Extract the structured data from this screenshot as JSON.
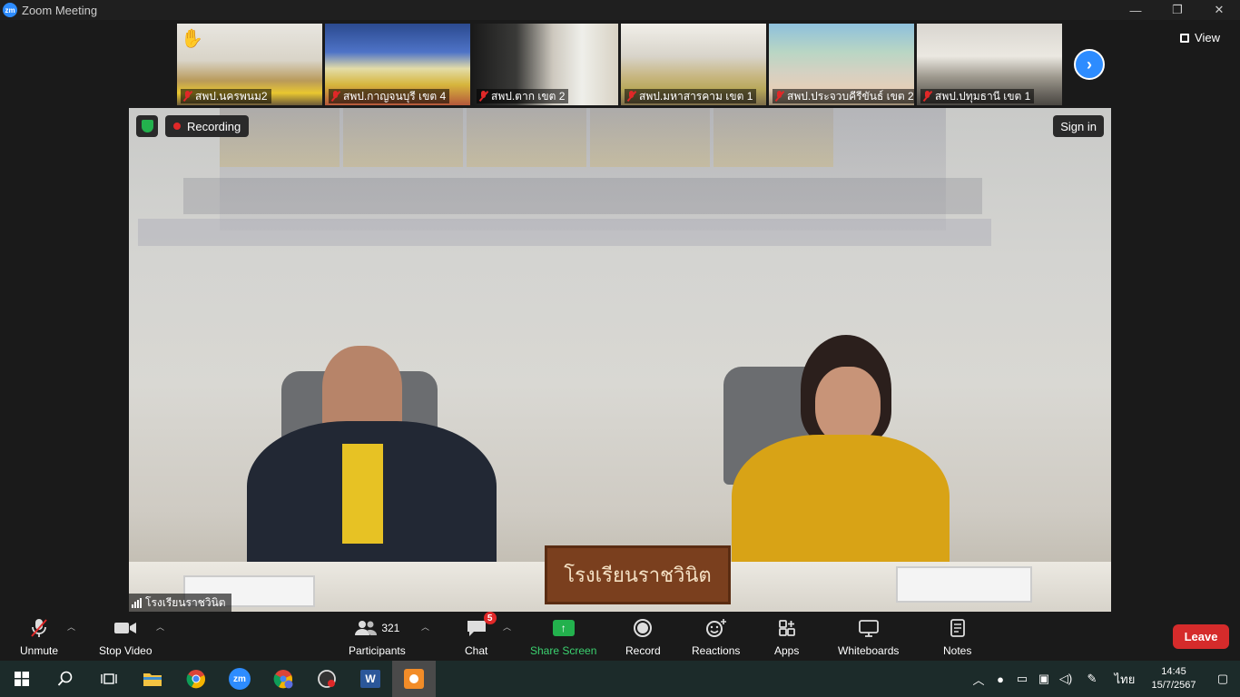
{
  "window": {
    "app_icon_text": "zm",
    "title": "Zoom Meeting",
    "controls": [
      "—",
      "❐",
      "✕"
    ]
  },
  "gallery": {
    "thumbnails": [
      {
        "label": "สพป.นครพนม2",
        "muted": true,
        "raised_hand": true
      },
      {
        "label": "สพป.กาญจนบุรี เขต 4",
        "muted": true,
        "raised_hand": false
      },
      {
        "label": "สพป.ตาก เขต 2",
        "muted": true,
        "raised_hand": false
      },
      {
        "label": "สพป.มหาสารคาม เขต 1",
        "muted": true,
        "raised_hand": false
      },
      {
        "label": "สพป.ประจวบคีรีขันธ์ เขต 2",
        "muted": true,
        "raised_hand": false
      },
      {
        "label": "สพป.ปทุมธานี เขต 1",
        "muted": true,
        "raised_hand": false
      }
    ],
    "next_arrow": "›",
    "view_label": "View"
  },
  "main_video": {
    "recording_label": "Recording",
    "sign_in_label": "Sign in",
    "speaker_name": "โรงเรียนราชวินิต",
    "sign_text": "โรงเรียนราชวินิต"
  },
  "toolbar": {
    "unmute": "Unmute",
    "stop_video": "Stop Video",
    "participants": "Participants",
    "participant_count": "321",
    "chat": "Chat",
    "chat_badge": "5",
    "share_screen": "Share Screen",
    "record": "Record",
    "reactions": "Reactions",
    "apps": "Apps",
    "whiteboards": "Whiteboards",
    "notes": "Notes",
    "leave": "Leave"
  },
  "taskbar": {
    "apps": [
      "start-icon",
      "search-icon",
      "task-view-icon",
      "file-explorer-icon",
      "chrome-icon",
      "zoom-icon",
      "chrome-profile-icon",
      "app-icon",
      "word-icon",
      "active-app-icon"
    ],
    "language": "ไทย",
    "time": "14:45",
    "date": "15/7/2567"
  }
}
